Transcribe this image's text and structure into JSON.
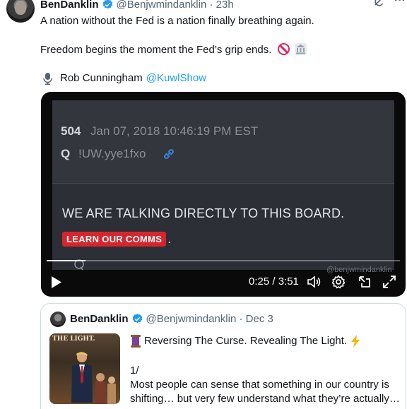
{
  "author": {
    "name": "BenDanklin",
    "handle": "@Benjwmindanklin",
    "time": "23h"
  },
  "tweet": {
    "line1": "A nation without the Fed is a nation finally breathing again.",
    "line2": "Freedom begins the moment the Fed’s grip ends.",
    "credit_name": "Rob Cunningham",
    "credit_mention": "@KuwlShow"
  },
  "video": {
    "post_number": "504",
    "post_date": "Jan 07, 2018 10:46:19 PM EST",
    "post_q": "Q",
    "post_trip": "!UW.yye1fxo",
    "post_body": "WE ARE TALKING DIRECTLY TO THIS BOARD.",
    "comms_badge": "LEARN OUR COMMS",
    "comms_dot": ".",
    "watermark": "@benjwmindanklin",
    "time_label": "0:25 / 3:51",
    "progress_fraction": 0.109
  },
  "quote": {
    "name": "BenDanklin",
    "handle": "@Benjwmindanklin",
    "date": "Dec 3",
    "thumb_title": "THE LIGHT.",
    "line1": "Reversing The Curse. Revealing The Light.",
    "line2": "1/",
    "line3": "Most people can sense that something in our country is",
    "line4": "shifting… but very few understand what they’re actually…"
  },
  "colors": {
    "link": "#1d9bf0",
    "verified": "#1d9bf0",
    "comms_badge": "#d6262d",
    "secondary_text": "#536471"
  },
  "icons": [
    "grok-icon",
    "more-icon",
    "verified-icon",
    "no-entry-emoji",
    "bank-emoji",
    "microphone-icon",
    "share-icon",
    "download-icon",
    "forward-icon",
    "link-icon",
    "play-icon",
    "volume-icon",
    "settings-icon",
    "pip-icon",
    "fullscreen-icon",
    "thread-emoji",
    "lightning-emoji"
  ]
}
